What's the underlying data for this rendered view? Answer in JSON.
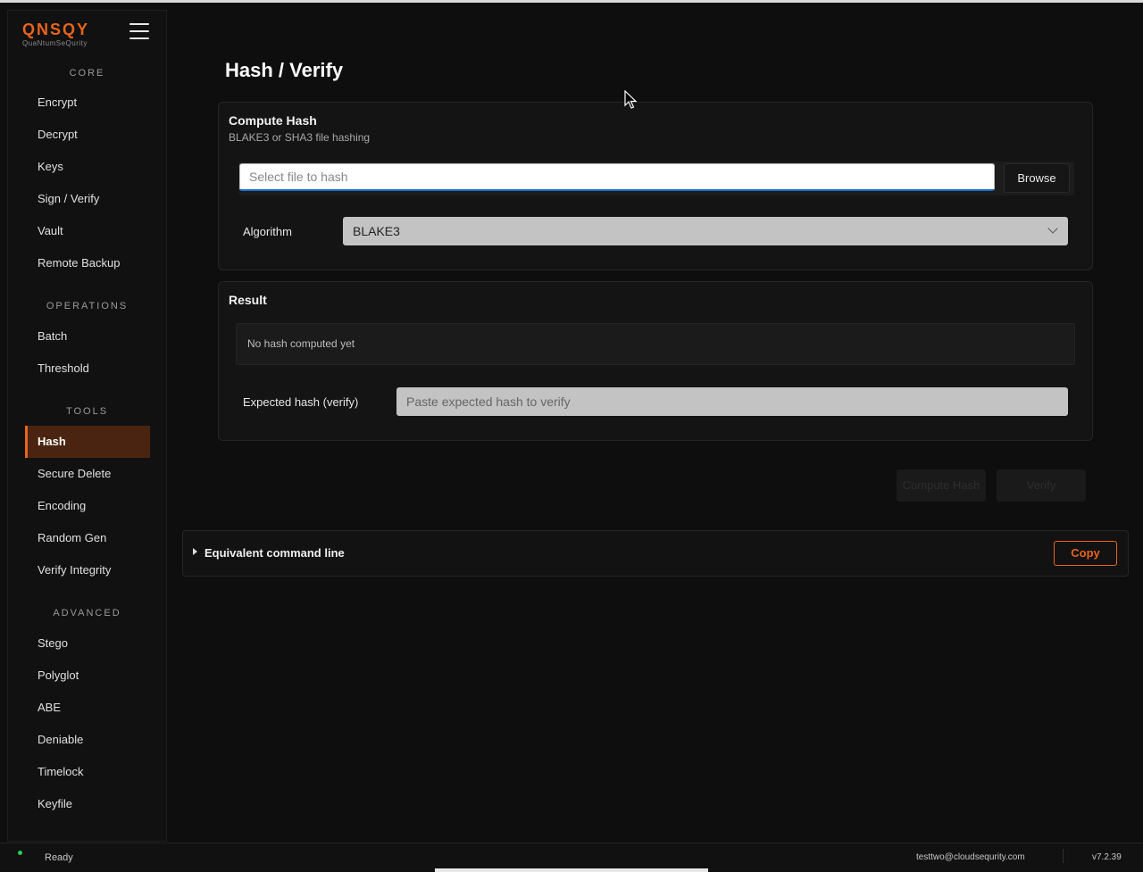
{
  "app": {
    "logo_text": "QNSQY",
    "logo_sub": "QuaNtumSeQurity"
  },
  "sidebar": {
    "sections": [
      {
        "label": "CORE",
        "items": [
          "Encrypt",
          "Decrypt",
          "Keys",
          "Sign / Verify",
          "Vault",
          "Remote Backup"
        ]
      },
      {
        "label": "OPERATIONS",
        "items": [
          "Batch",
          "Threshold"
        ]
      },
      {
        "label": "TOOLS",
        "items": [
          "Hash",
          "Secure Delete",
          "Encoding",
          "Random Gen",
          "Verify Integrity"
        ]
      },
      {
        "label": "ADVANCED",
        "items": [
          "Stego",
          "Polyglot",
          "ABE",
          "Deniable",
          "Timelock",
          "Keyfile"
        ]
      }
    ],
    "active_item": "Hash"
  },
  "page": {
    "title": "Hash / Verify"
  },
  "compute": {
    "title": "Compute Hash",
    "subtitle": "BLAKE3 or SHA3 file hashing",
    "file_placeholder": "Select file to hash",
    "browse_label": "Browse",
    "algorithm_label": "Algorithm",
    "algorithm_value": "BLAKE3"
  },
  "result": {
    "title": "Result",
    "empty_text": "No hash computed yet",
    "expected_label": "Expected hash (verify)",
    "expected_placeholder": "Paste expected hash to verify"
  },
  "actions": {
    "compute_label": "Compute Hash",
    "verify_label": "Verify"
  },
  "command_line": {
    "label": "Equivalent command line",
    "copy_label": "Copy"
  },
  "status": {
    "text": "Ready",
    "email": "testtwo@cloudsequrity.com",
    "version": "v7.2.39"
  },
  "colors": {
    "accent": "#e8641e",
    "active_bg": "#4a2410",
    "status_ok": "#2ecc55"
  }
}
